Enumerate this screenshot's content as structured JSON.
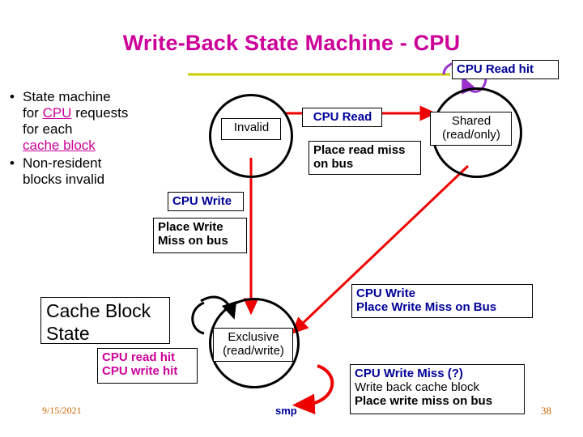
{
  "slide": {
    "title": "Write-Back State Machine - CPU",
    "date": "9/15/2021",
    "footer_label": "smp",
    "page_number": "38"
  },
  "bullets": [
    {
      "marker": "•",
      "lines": [
        [
          {
            "t": "State machine",
            "style": "plain"
          }
        ],
        [
          {
            "t": "for ",
            "style": "plain"
          },
          {
            "t": "CPU",
            "style": "underline-magenta"
          },
          {
            "t": " requests",
            "style": "plain"
          }
        ],
        [
          {
            "t": "for each",
            "style": "plain"
          }
        ],
        [
          {
            "t": "cache block",
            "style": "underline-magenta"
          }
        ]
      ]
    },
    {
      "marker": "•",
      "lines": [
        [
          {
            "t": "Non-resident",
            "style": "plain"
          }
        ],
        [
          {
            "t": "blocks invalid",
            "style": "plain"
          }
        ]
      ]
    }
  ],
  "states": {
    "invalid": "Invalid",
    "shared_line1": "Shared",
    "shared_line2": "(read/only)",
    "exclusive_line1": "Exclusive",
    "exclusive_line2": "(read/write)"
  },
  "labels": {
    "cpu_read_hit": "CPU Read hit",
    "cpu_read": "CPU Read",
    "place_read_miss_l1": "Place read miss",
    "place_read_miss_l2": "on bus",
    "cpu_write": "CPU Write",
    "place_write_miss_l1": "Place Write",
    "place_write_miss_l2": "Miss on bus",
    "cache_block_state_l1": "Cache Block",
    "cache_block_state_l2": "State",
    "cpu_read_hit_small": "CPU read hit",
    "cpu_write_hit_small": "CPU write hit",
    "cpu_write_right_l1": "CPU Write",
    "cpu_write_right_l2": "Place Write Miss on Bus",
    "cpu_write_miss_l1": "CPU Write Miss (?)",
    "cpu_write_miss_l2": "Write back cache block",
    "cpu_write_miss_l3": "Place write miss on bus"
  },
  "colors": {
    "title": "#cc0099",
    "accent_blue": "#000099",
    "arrow_red": "#ee0000",
    "arrow_purple": "#9933cc",
    "arrow_yellow": "#cccc00",
    "arrow_black": "#000000",
    "date": "#cc6600"
  }
}
